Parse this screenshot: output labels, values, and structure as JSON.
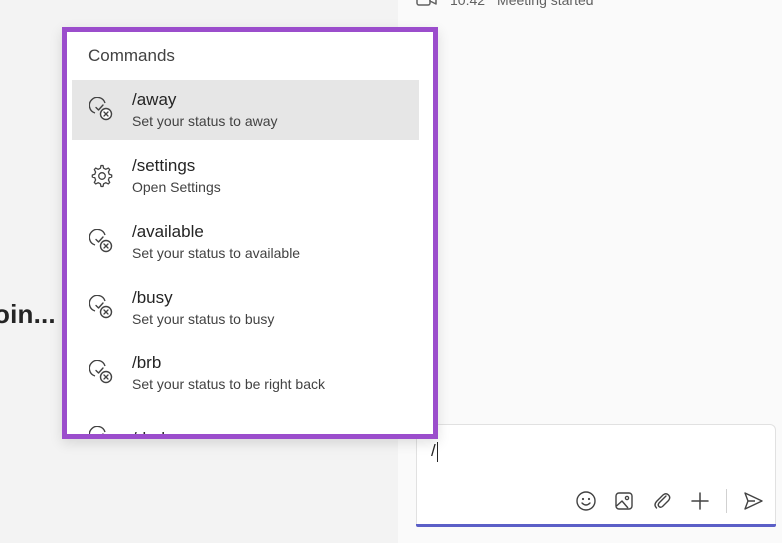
{
  "left_pane": {
    "title": "oin..."
  },
  "chat": {
    "meeting": {
      "icon": "video-camera-icon",
      "time": "10:42",
      "text": "Meeting started"
    }
  },
  "composer": {
    "value": "/",
    "tools": [
      {
        "name": "emoji-icon"
      },
      {
        "name": "image-icon"
      },
      {
        "name": "attach-icon"
      },
      {
        "name": "plus-icon"
      },
      {
        "name": "send-icon"
      }
    ],
    "accent_color": "#5b5fc7"
  },
  "commands_popup": {
    "header": "Commands",
    "border_color": "#9b4dcc",
    "items": [
      {
        "command": "/away",
        "description": "Set your status to away",
        "icon": "status-icon",
        "selected": true
      },
      {
        "command": "/settings",
        "description": "Open Settings",
        "icon": "gear-icon",
        "selected": false
      },
      {
        "command": "/available",
        "description": "Set your status to available",
        "icon": "status-icon",
        "selected": false
      },
      {
        "command": "/busy",
        "description": "Set your status to busy",
        "icon": "status-icon",
        "selected": false
      },
      {
        "command": "/brb",
        "description": "Set your status to be right back",
        "icon": "status-icon",
        "selected": false
      },
      {
        "command": "/dnd",
        "description": "",
        "icon": "status-icon",
        "selected": false
      }
    ]
  }
}
